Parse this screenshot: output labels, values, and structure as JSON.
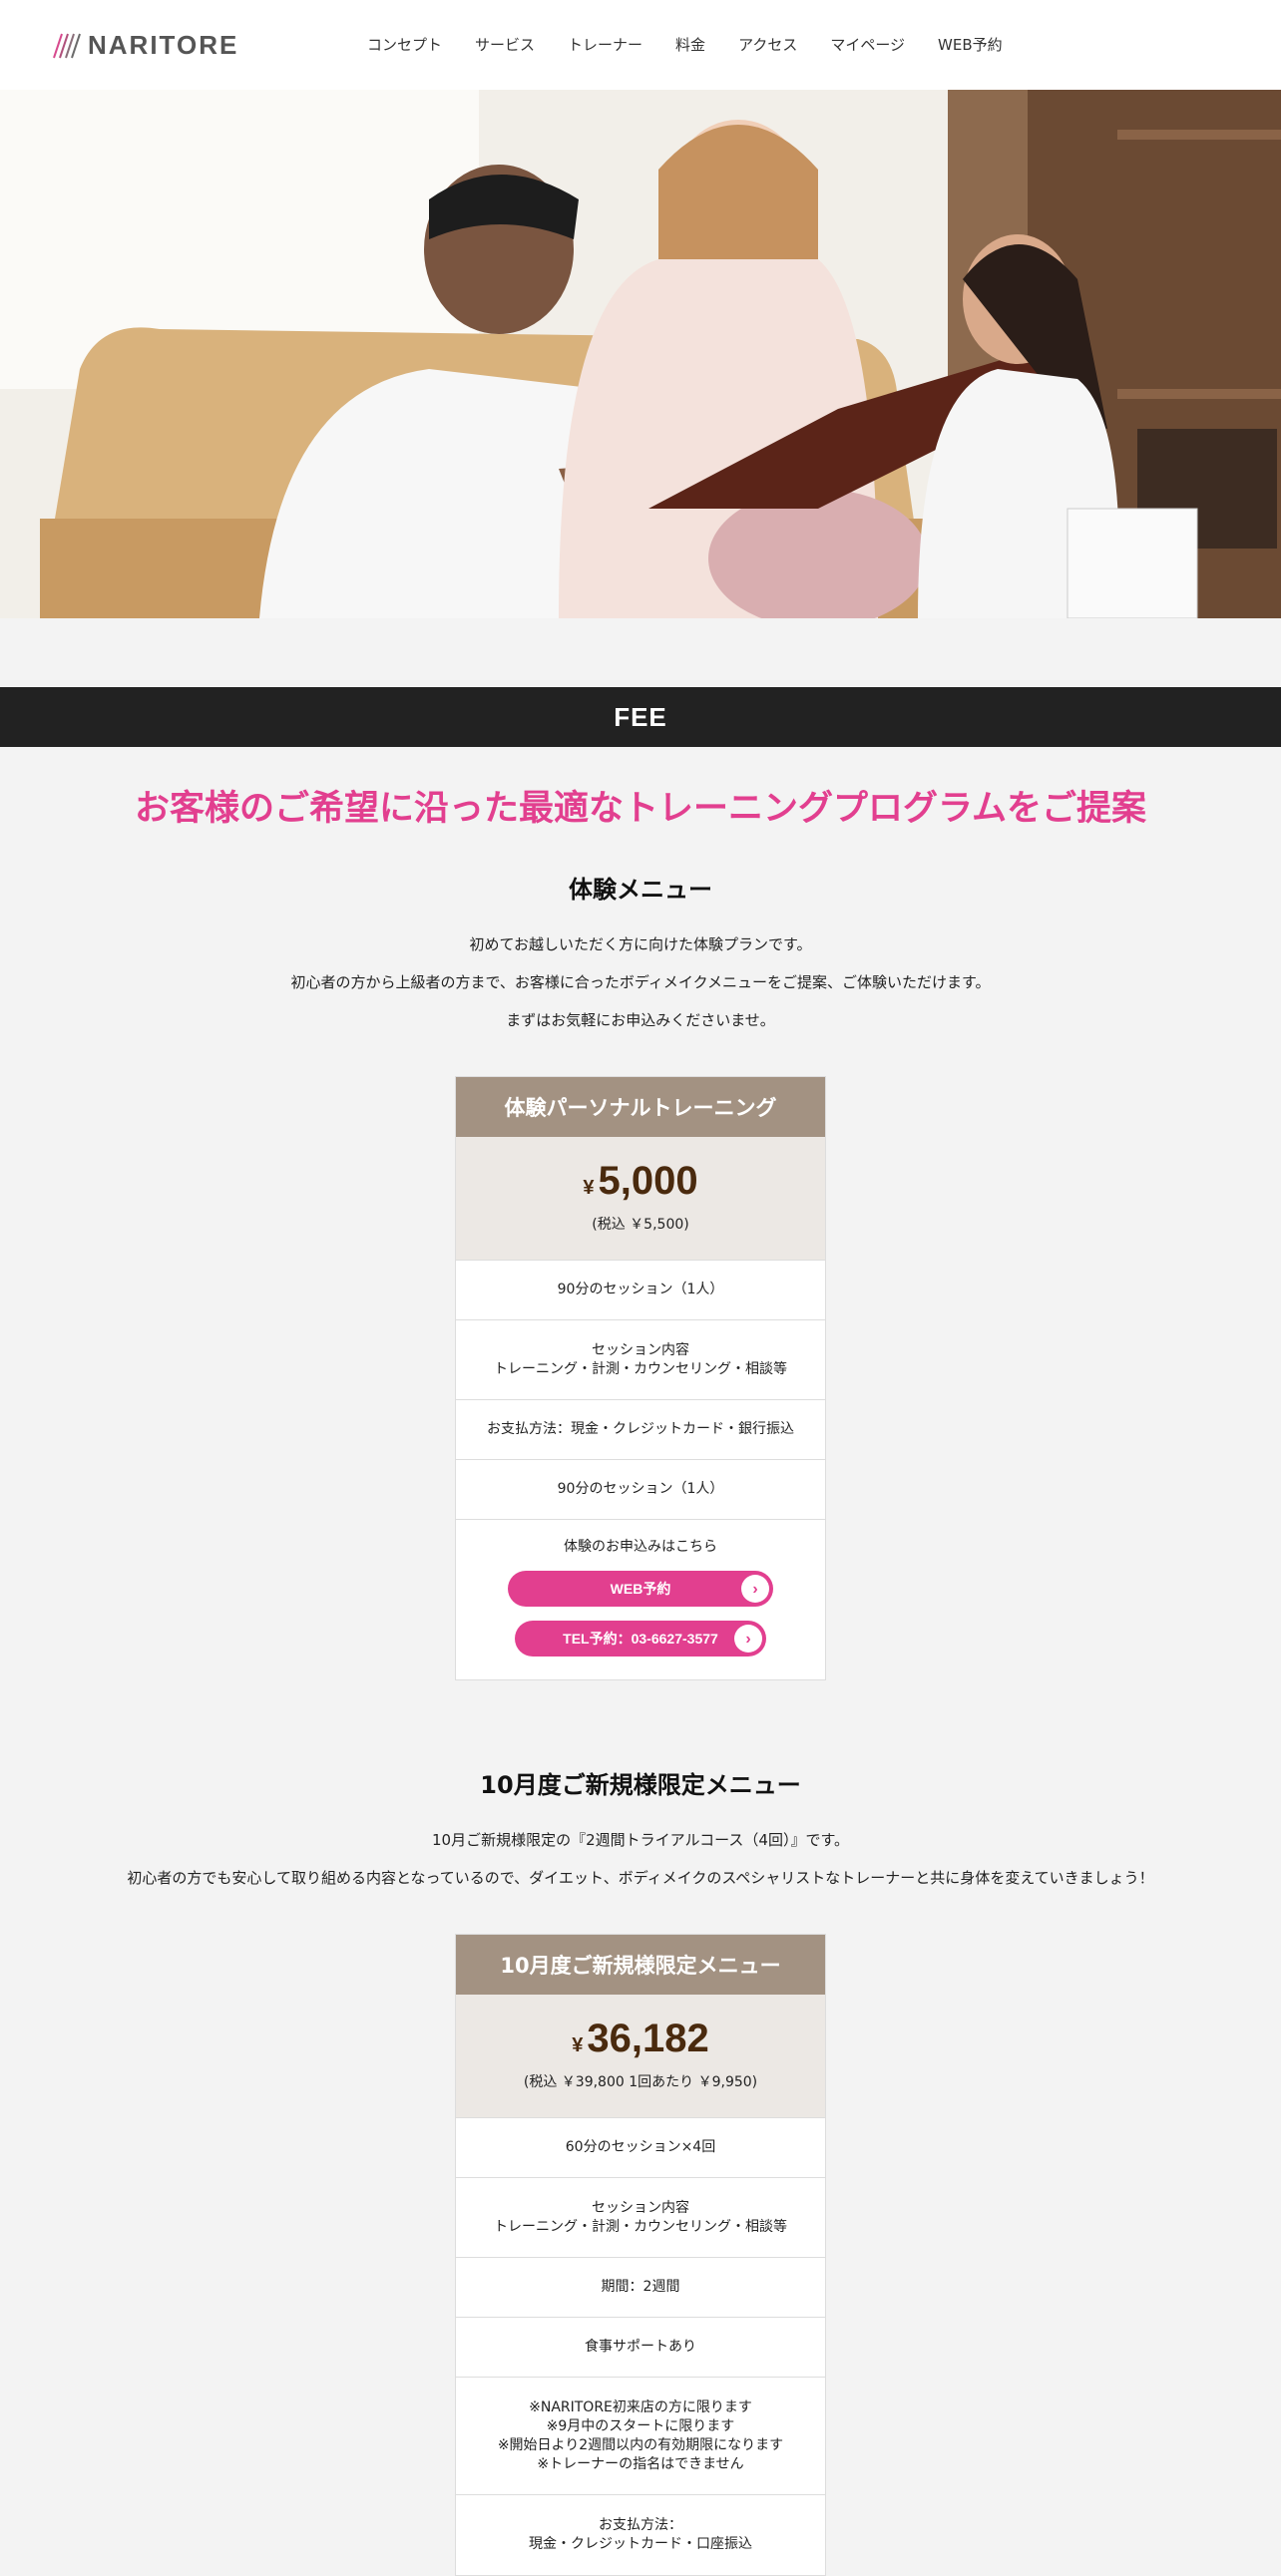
{
  "header": {
    "logo_text": "NARITORE",
    "nav": [
      "コンセプト",
      "サービス",
      "トレーナー",
      "料金",
      "アクセス",
      "マイページ",
      "WEB予約"
    ]
  },
  "fee": {
    "bar_label": "FEE",
    "headline": "お客様のご希望に沿った最適なトレーニングプログラムをご提案"
  },
  "trial": {
    "title": "体験メニュー",
    "paragraphs": [
      "初めてお越しいただく方に向けた体験プランです。",
      "初心者の方から上級者の方まで、お客様に合ったボディメイクメニューをご提案、ご体験いただけます。",
      "まずはお気軽にお申込みくださいませ。"
    ],
    "card": {
      "head": "体験パーソナルトレーニング",
      "yen": "¥",
      "price": "5,000",
      "tax": "(税込 ￥5,500)",
      "rows": [
        "90分のセッション（1人）",
        "セッション内容",
        "トレーニング・計測・カウンセリング・相談等",
        "お支払方法：現金・クレジットカード・銀行振込",
        "90分のセッション（1人）"
      ],
      "apply_label": "体験のお申込みはこちら",
      "web_button": "WEB予約",
      "tel_button": "TEL予約：03-6627-3577"
    }
  },
  "october": {
    "title": "10月度ご新規様限定メニュー",
    "paragraphs": [
      "10月ご新規様限定の『2週間トライアルコース（4回）』です。",
      "初心者の方でも安心して取り組める内容となっているので、ダイエット、ボディメイクのスペシャリストなトレーナーと共に身体を変えていきましょう！"
    ],
    "card": {
      "head": "10月度ご新規様限定メニュー",
      "yen": "¥",
      "price": "36,182",
      "tax": "(税込 ￥39,800 1回あたり ￥9,950)",
      "rows": [
        "60分のセッション×4回",
        "セッション内容",
        "トレーニング・計測・カウンセリング・相談等",
        "期間：2週間",
        "食事サポートあり",
        "※NARITORE初来店の方に限ります",
        "※9月中のスタートに限ります",
        "※開始日より2週間以内の有効期限になります",
        "※トレーナーの指名はできません",
        "お支払方法：",
        "現金・クレジットカード・口座振込"
      ]
    }
  },
  "colors": {
    "accent": "#e23f8f",
    "card_head": "#a39282",
    "price": "#4a2a0e",
    "bar": "#222222"
  }
}
